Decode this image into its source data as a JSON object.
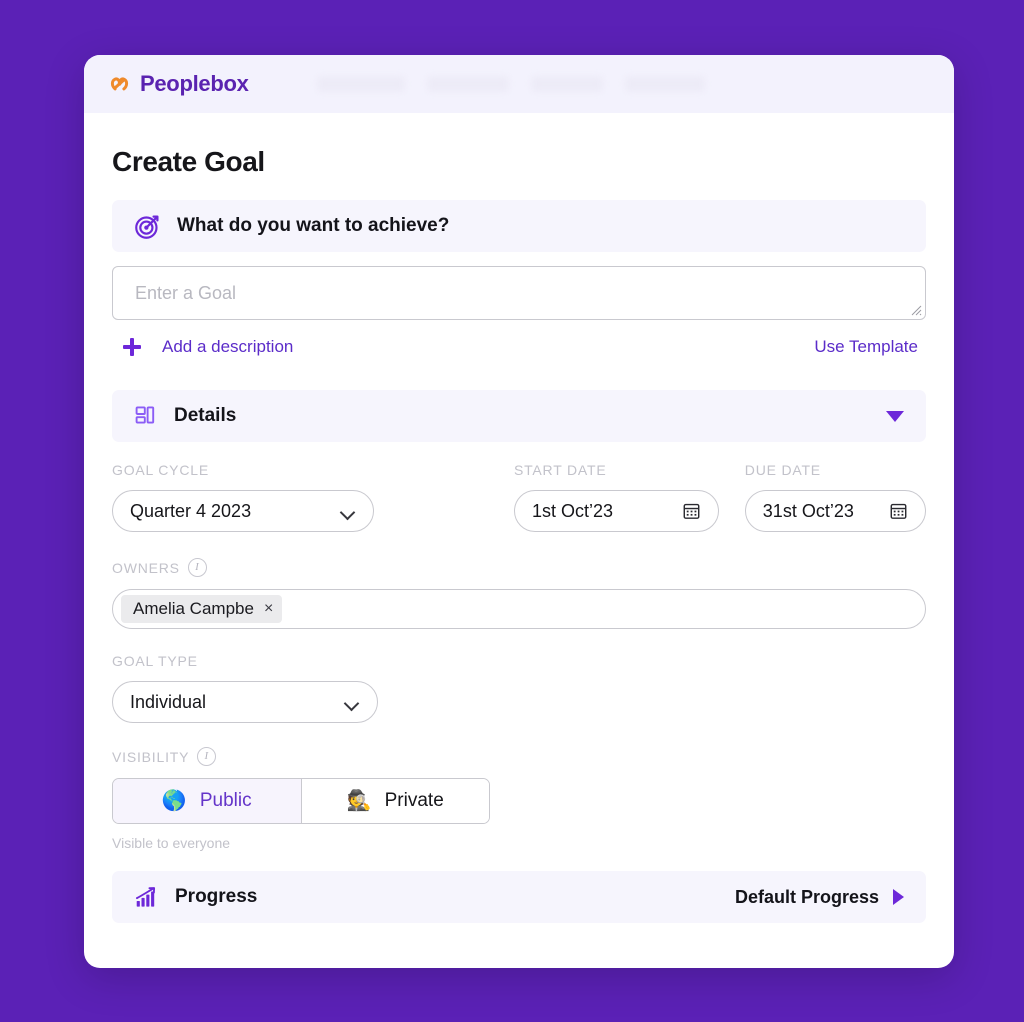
{
  "header": {
    "brand_name": "Peoplebox",
    "nav_placeholder_widths": [
      88,
      82,
      72,
      80
    ]
  },
  "page": {
    "title": "Create Goal"
  },
  "achieve_section": {
    "label": "What do you want to achieve?",
    "icon": "target-icon"
  },
  "goal_input": {
    "value": "",
    "placeholder": "Enter a Goal"
  },
  "description_row": {
    "add_description_label": "Add a description",
    "use_template_label": "Use Template"
  },
  "details_section": {
    "label": "Details",
    "expanded": true
  },
  "fields": {
    "goal_cycle": {
      "label": "GOAL CYCLE",
      "value": "Quarter 4 2023"
    },
    "start_date": {
      "label": "START DATE",
      "value": "1st Oct’23"
    },
    "due_date": {
      "label": "DUE DATE",
      "value": "31st Oct’23"
    },
    "owners": {
      "label": "OWNERS",
      "chips": [
        {
          "name": "Amelia Campbe",
          "remove": "×"
        }
      ]
    },
    "goal_type": {
      "label": "GOAL TYPE",
      "value": "Individual"
    },
    "visibility": {
      "label": "VISIBILITY",
      "public_label": "Public",
      "private_label": "Private",
      "selected": "Public",
      "hint": "Visible to everyone"
    }
  },
  "progress_section": {
    "label": "Progress",
    "value_label": "Default Progress"
  },
  "colors": {
    "page_background": "#5b21b6",
    "brand_purple": "#5a23b0",
    "brand_mark_orange": "#ef8a2b",
    "accent_purple": "#6d28d9",
    "section_bar_background": "#f6f5fd",
    "appbar_background": "#f3f2fd",
    "label_gray": "#c2c2ca",
    "card_background": "#ffffff"
  }
}
